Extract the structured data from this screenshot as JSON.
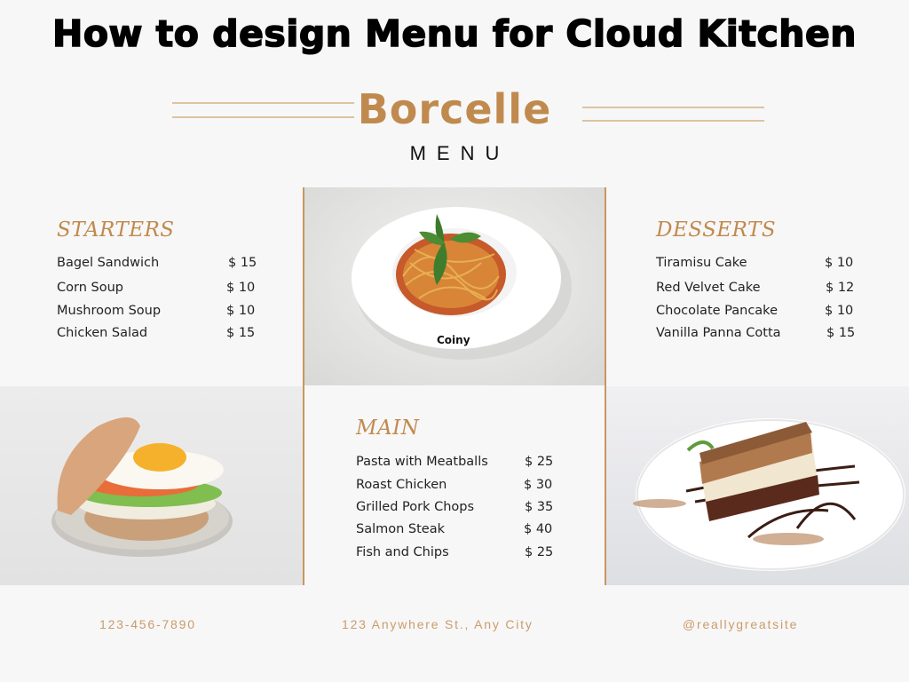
{
  "header": {
    "title": "How to design Menu for Cloud Kitchen",
    "brand": "Borcelle",
    "subtitle": "MENU"
  },
  "colors": {
    "accent": "#c08a4e",
    "line": "#dcc3a3",
    "divider": "#c9965f",
    "background": "#f8f7f7",
    "text": "#222222",
    "footer": "#c99c6b"
  },
  "starters": {
    "title": "STARTERS",
    "items": [
      {
        "name": "Bagel Sandwich",
        "price": "$ 15"
      },
      {
        "name": "Corn Soup",
        "price": "$ 10"
      },
      {
        "name": "Mushroom Soup",
        "price": "$ 10"
      },
      {
        "name": "Chicken Salad",
        "price": "$ 15"
      }
    ]
  },
  "desserts": {
    "title": "DESSERTS",
    "items": [
      {
        "name": "Tiramisu Cake",
        "price": "$ 10"
      },
      {
        "name": "Red Velvet Cake",
        "price": "$ 12"
      },
      {
        "name": "Chocolate Pancake",
        "price": "$ 10"
      },
      {
        "name": "Vanilla Panna Cotta",
        "price": "$ 15"
      }
    ]
  },
  "main": {
    "title": "MAIN",
    "items": [
      {
        "name": "Pasta with Meatballs",
        "price": "$ 25"
      },
      {
        "name": "Roast Chicken",
        "price": "$ 30"
      },
      {
        "name": "Grilled Pork Chops",
        "price": "$ 35"
      },
      {
        "name": "Salmon Steak",
        "price": "$ 40"
      },
      {
        "name": "Fish and Chips",
        "price": "$ 25"
      }
    ]
  },
  "photos": {
    "pasta": {
      "label": "spaghetti-photo",
      "plate_text": "Coiny"
    },
    "sandwich": {
      "label": "bagel-sandwich-photo"
    },
    "cake": {
      "label": "tiramisu-cake-photo"
    }
  },
  "footer": {
    "phone": "123-456-7890",
    "address": "123 Anywhere St., Any City",
    "website": "@reallygreatsite"
  }
}
